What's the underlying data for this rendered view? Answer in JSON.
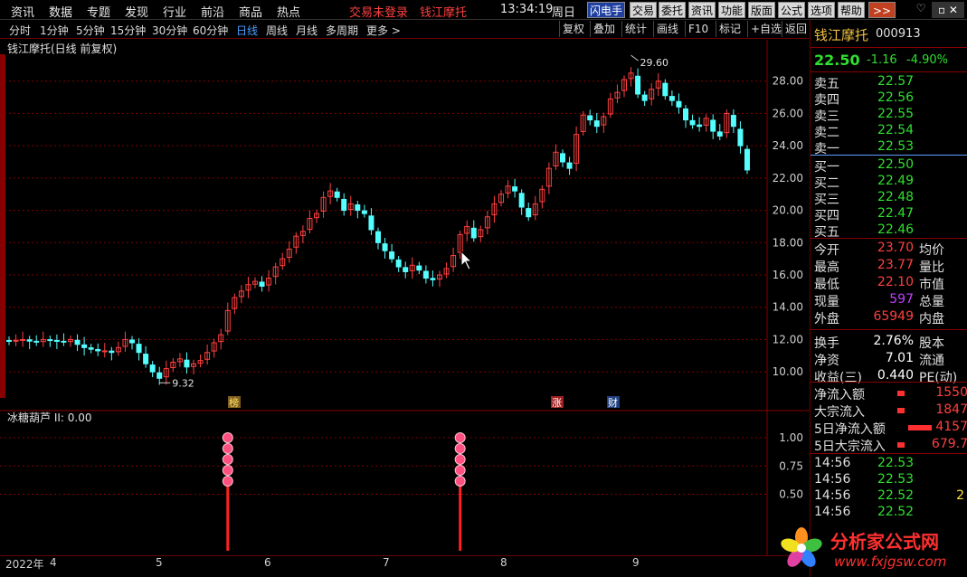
{
  "menu": {
    "items": [
      "资讯",
      "数据",
      "专题",
      "发现",
      "行业",
      "前沿",
      "商品",
      "热点"
    ],
    "login": "交易未登录",
    "stock": "钱江摩托",
    "time": "13:34:19",
    "weekday": "周日",
    "buttons": [
      "闪电手",
      "交易",
      "委托",
      "资讯",
      "功能",
      "版面",
      "公式",
      "选项",
      "帮助",
      ">>"
    ]
  },
  "periods": [
    "分时",
    "1分钟",
    "5分钟",
    "15分钟",
    "30分钟",
    "60分钟",
    "日线",
    "周线",
    "月线",
    "多周期",
    "更多 >"
  ],
  "toolbar": [
    "复权",
    "叠加",
    "统计",
    "画线",
    "F10",
    "标记",
    "+自选",
    "返回"
  ],
  "chart": {
    "title": "钱江摩托(日线 前复权)",
    "high_label": "29.60",
    "low_label": "9.32",
    "yticks": [
      "28.00",
      "26.00",
      "24.00",
      "22.00",
      "20.00",
      "18.00",
      "16.00",
      "14.00",
      "12.00",
      "10.00"
    ],
    "markers": [
      "榜",
      "涨",
      "财"
    ],
    "indicator_title": "冰糖葫芦 II: 0.00",
    "ind_yticks": [
      "1.00",
      "0.75",
      "0.50"
    ],
    "xlabels": [
      "2022年",
      "4",
      "5",
      "6",
      "7",
      "8",
      "9"
    ]
  },
  "chart_data": {
    "type": "candlestick",
    "title": "钱江摩托(日线 前复权)",
    "ylim": [
      9,
      30
    ],
    "high": 29.6,
    "low": 9.32,
    "close": [
      11.9,
      11.95,
      12.0,
      11.9,
      11.85,
      12.0,
      11.95,
      11.9,
      11.85,
      12.0,
      11.7,
      11.5,
      11.4,
      11.3,
      11.3,
      11.2,
      11.5,
      12.0,
      11.8,
      11.2,
      10.5,
      10.0,
      9.6,
      10.2,
      10.6,
      10.8,
      10.3,
      10.5,
      10.7,
      11.2,
      11.8,
      12.3,
      13.8,
      14.6,
      15.0,
      15.4,
      15.6,
      15.3,
      15.8,
      16.5,
      17.0,
      17.6,
      18.4,
      18.7,
      19.5,
      19.8,
      20.8,
      21.2,
      20.8,
      20.0,
      20.4,
      20.0,
      19.8,
      18.8,
      18.0,
      17.5,
      17.0,
      16.5,
      16.2,
      16.6,
      16.3,
      15.8,
      15.7,
      16.0,
      16.4,
      17.2,
      18.5,
      19.0,
      18.3,
      18.8,
      19.6,
      20.4,
      21.0,
      21.5,
      21.2,
      20.2,
      19.6,
      20.4,
      21.3,
      22.6,
      23.6,
      23.0,
      22.6,
      24.7,
      25.9,
      25.6,
      25.2,
      25.8,
      26.9,
      27.3,
      28.1,
      28.5,
      27.2,
      26.8,
      27.5,
      28.0,
      27.1,
      26.8,
      26.4,
      25.6,
      25.3,
      25.2,
      25.7,
      24.9,
      24.6,
      26.0,
      25.2,
      24.0,
      22.5
    ],
    "indicator_signal_days": [
      32,
      66
    ]
  },
  "quote": {
    "name": "钱江摩托",
    "code": "000913",
    "price": "22.50",
    "change": "-1.16",
    "pct": "-4.90%",
    "asks": [
      [
        "卖五",
        "22.57"
      ],
      [
        "卖四",
        "22.56"
      ],
      [
        "卖三",
        "22.55"
      ],
      [
        "卖二",
        "22.54"
      ],
      [
        "卖一",
        "22.53"
      ]
    ],
    "bids": [
      [
        "买一",
        "22.50"
      ],
      [
        "买二",
        "22.49"
      ],
      [
        "买三",
        "22.48"
      ],
      [
        "买四",
        "22.47"
      ],
      [
        "买五",
        "22.46"
      ]
    ],
    "stats": [
      [
        "今开",
        "23.70",
        "均价"
      ],
      [
        "最高",
        "23.77",
        "量比"
      ],
      [
        "最低",
        "22.10",
        "市值"
      ],
      [
        "现量",
        "597",
        "总量"
      ],
      [
        "外盘",
        "65949",
        "内盘"
      ]
    ],
    "stats2": [
      [
        "换手",
        "2.76%",
        "股本"
      ],
      [
        "净资",
        "7.01",
        "流通"
      ],
      [
        "收益(三)",
        "0.440",
        "PE(动)"
      ]
    ],
    "flows": [
      [
        "净流入额",
        "1550"
      ],
      [
        "大宗流入",
        "1847"
      ],
      [
        "5日净流入额",
        "4157"
      ],
      [
        "5日大宗流入",
        "679.7"
      ]
    ],
    "ticks": [
      [
        "14:56",
        "22.53",
        ""
      ],
      [
        "14:56",
        "22.53",
        ""
      ],
      [
        "14:56",
        "22.52",
        "2"
      ],
      [
        "14:56",
        "22.52",
        ""
      ]
    ]
  },
  "colors": {
    "up": "#ff4040",
    "down": "#54ffff",
    "grid": "#800000"
  }
}
